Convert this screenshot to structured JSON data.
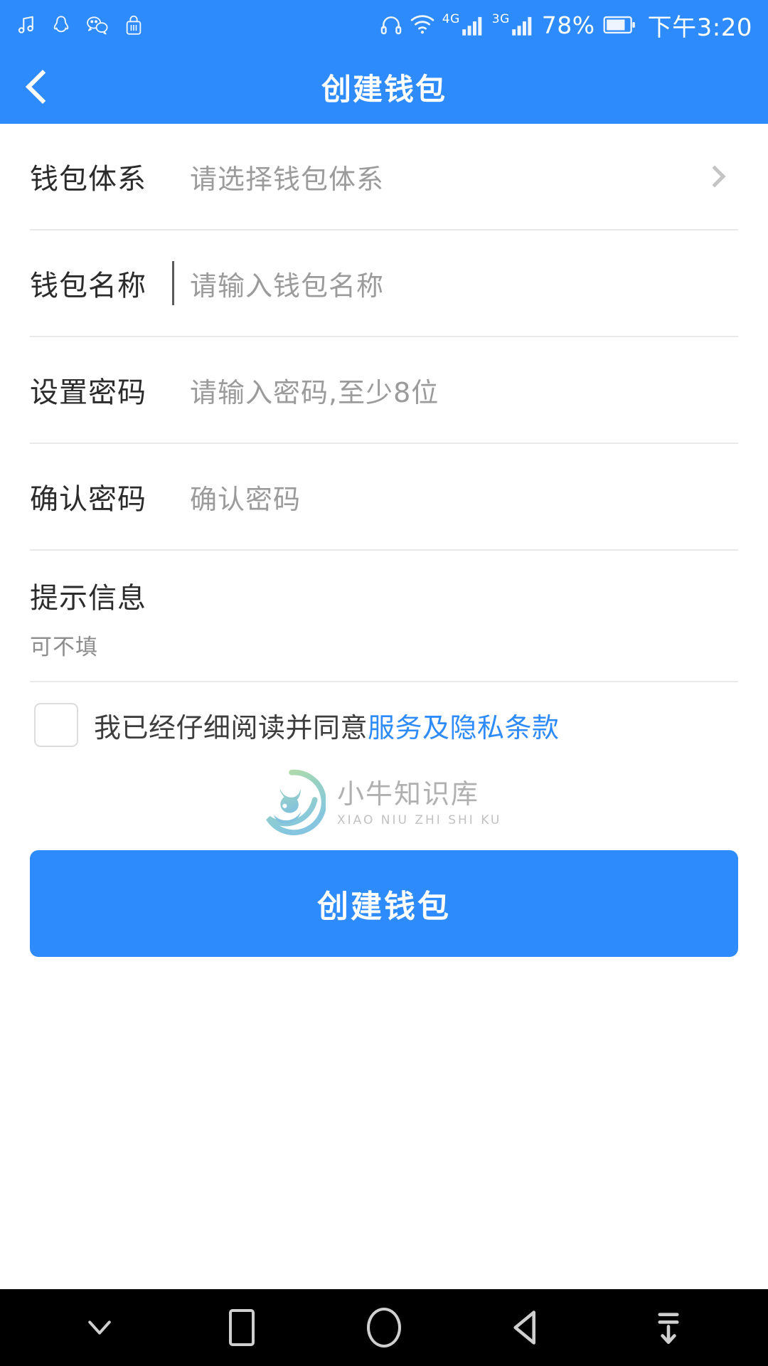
{
  "status_bar": {
    "left_icons": [
      "music-note-icon",
      "qq-penguin-icon",
      "wechat-icon",
      "lock-app-icon"
    ],
    "right": {
      "headphone_icon": "headphone-icon",
      "wifi_icon": "wifi-icon",
      "signal1_gen": "4G",
      "signal2_gen": "3G",
      "battery_percent": "78%",
      "battery_icon": "battery-icon",
      "time": "下午3:20"
    }
  },
  "header": {
    "back_icon": "chevron-left-icon",
    "title": "创建钱包"
  },
  "form": {
    "rows": [
      {
        "label": "钱包体系",
        "placeholder": "请选择钱包体系",
        "type": "select",
        "chevron": "chevron-right-icon"
      },
      {
        "label": "钱包名称",
        "placeholder": "请输入钱包名称",
        "type": "text",
        "focused": true
      },
      {
        "label": "设置密码",
        "placeholder": "请输入密码,至少8位",
        "type": "password"
      },
      {
        "label": "确认密码",
        "placeholder": "确认密码",
        "type": "password"
      }
    ],
    "hint": {
      "title": "提示信息",
      "sub": "可不填"
    },
    "agreement": {
      "checked": false,
      "text": "我已经仔细阅读并同意",
      "link_text": "服务及隐私条款"
    },
    "submit_label": "创建钱包"
  },
  "watermark": {
    "cn": "小牛知识库",
    "en": "XIAO NIU ZHI SHI KU",
    "logo": "bull-circle-logo"
  },
  "nav_bar": {
    "items": [
      {
        "name": "hide-keyboard",
        "icon": "chevron-down-icon"
      },
      {
        "name": "recents",
        "icon": "square-icon"
      },
      {
        "name": "home",
        "icon": "circle-icon"
      },
      {
        "name": "back",
        "icon": "triangle-left-icon"
      },
      {
        "name": "pull-down",
        "icon": "download-arrow-icon"
      }
    ]
  },
  "colors": {
    "brand_blue": "#2E8BFB",
    "link_blue": "#2E8BFB",
    "divider": "#e9e9e9",
    "nav_background": "#000000",
    "placeholder": "#9b9b9b"
  }
}
